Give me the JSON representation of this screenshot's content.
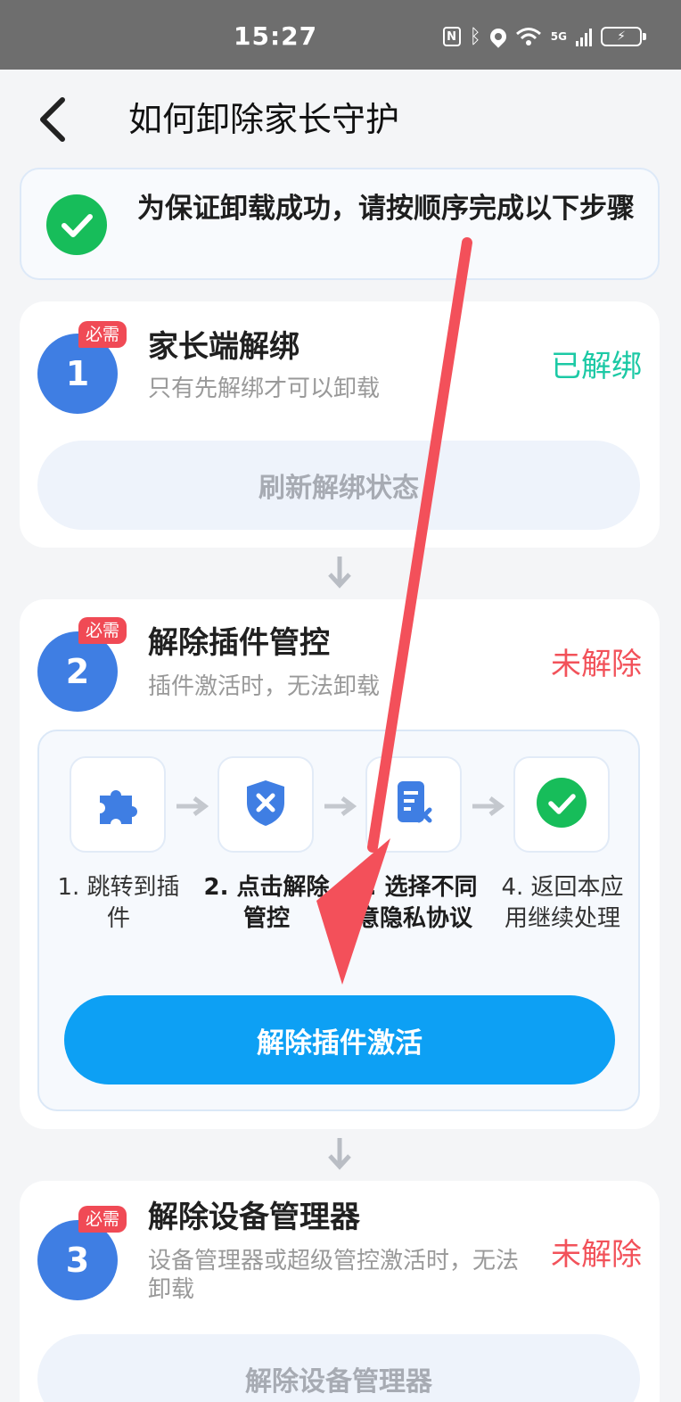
{
  "status_bar": {
    "time": "15:27",
    "network": "5G"
  },
  "header": {
    "title": "如何卸除家长守护"
  },
  "notice": {
    "text": "为保证卸载成功，请按顺序完成以下步骤"
  },
  "steps": [
    {
      "number": "1",
      "badge": "必需",
      "title": "家长端解绑",
      "subtitle": "只有先解绑才可以卸载",
      "status": "已解绑",
      "button": "刷新解绑状态"
    },
    {
      "number": "2",
      "badge": "必需",
      "title": "解除插件管控",
      "subtitle": "插件激活时，无法卸载",
      "status": "未解除",
      "button": "解除插件激活",
      "sub_steps": [
        {
          "icon": "puzzle-icon",
          "label": "1. 跳转到插件"
        },
        {
          "icon": "shield-x-icon",
          "label": "2. 点击解除管控"
        },
        {
          "icon": "document-x-icon",
          "label": "3. 选择不同意隐私协议"
        },
        {
          "icon": "check-circle-icon",
          "label": "4. 返回本应用继续处理"
        }
      ]
    },
    {
      "number": "3",
      "badge": "必需",
      "title": "解除设备管理器",
      "subtitle": "设备管理器或超级管控激活时，无法卸载",
      "status": "未解除",
      "button": "解除设备管理器"
    }
  ],
  "colors": {
    "accent_blue": "#3f7ee3",
    "primary_button": "#0da0f4",
    "done": "#1cc9a5",
    "pending": "#f2525a",
    "badge": "#f04a55",
    "annotation_arrow": "#f3505a"
  }
}
